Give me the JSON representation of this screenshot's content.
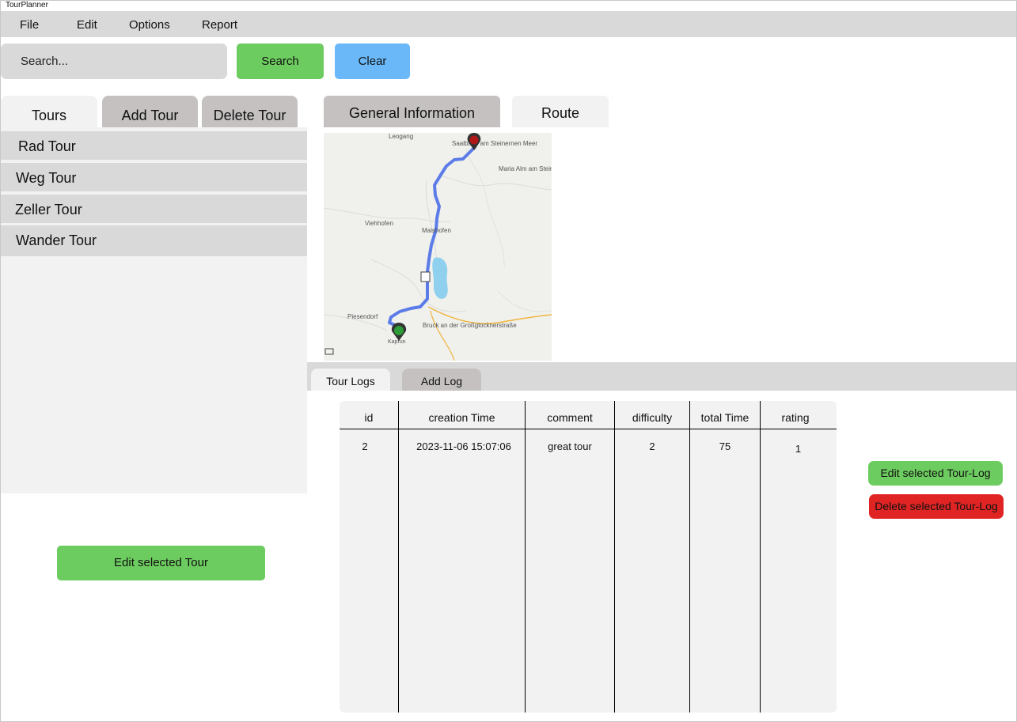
{
  "app": {
    "title": "TourPlanner"
  },
  "menu": {
    "items": [
      "File",
      "Edit",
      "Options",
      "Report"
    ]
  },
  "search": {
    "placeholder": "Search...",
    "search_label": "Search",
    "clear_label": "Clear"
  },
  "left_tabs": [
    "Tours",
    "Add Tour",
    "Delete Tour"
  ],
  "tours": [
    "Rad Tour",
    "Weg Tour",
    "Zeller Tour",
    "Wander Tour"
  ],
  "edit_tour_label": "Edit selected Tour",
  "detail_tabs": [
    "General Information",
    "Route"
  ],
  "map": {
    "labels": [
      "Leogang",
      "Saalbach am Steinernen Meer",
      "Maria Alm am Steinernen Meer",
      "Viehhofen",
      "Maishofen",
      "Piesendorf",
      "Bruck an der Großglocknerstraße",
      "Kaprun"
    ],
    "route_color": "#5b7ce8",
    "start_marker_color": "#2e9b3a",
    "end_marker_color": "#b01818"
  },
  "log_tabs": [
    "Tour Logs",
    "Add Log"
  ],
  "logs_table": {
    "columns": [
      "id",
      "creation Time",
      "comment",
      "difficulty",
      "total Time",
      "rating"
    ],
    "rows": [
      [
        "2",
        "2023-11-06 15:07:06",
        "great tour",
        "2",
        "75",
        "1"
      ]
    ]
  },
  "log_actions": {
    "edit_label": "Edit selected Tour-Log",
    "delete_label": "Delete selected Tour-Log"
  },
  "colors": {
    "green": "#6dcc5f",
    "blue": "#6ab8f7",
    "red": "#e02424",
    "gray": "#d9d9d9",
    "tab_dark": "#c5c1c1",
    "panel": "#f2f2f2"
  }
}
